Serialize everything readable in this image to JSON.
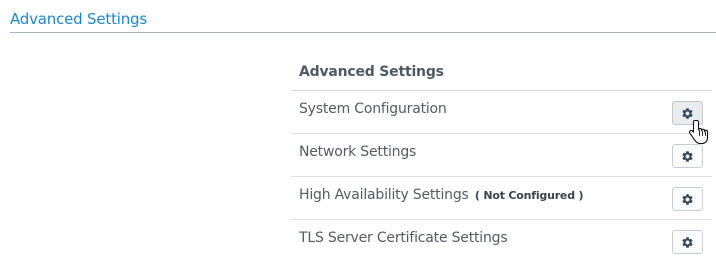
{
  "page": {
    "title": "Advanced Settings"
  },
  "panel": {
    "title": "Advanced Settings",
    "rows": [
      {
        "label": "System Configuration",
        "note": "",
        "icon": "gear-icon"
      },
      {
        "label": "Network Settings",
        "note": "",
        "icon": "gear-icon"
      },
      {
        "label": "High Availability Settings",
        "note": "( Not Configured )",
        "icon": "gear-icon"
      },
      {
        "label": "TLS Server Certificate Settings",
        "note": "",
        "icon": "gear-icon"
      }
    ]
  },
  "colors": {
    "title_accent": "#1f86c8",
    "gear_icon": "#34495e"
  }
}
